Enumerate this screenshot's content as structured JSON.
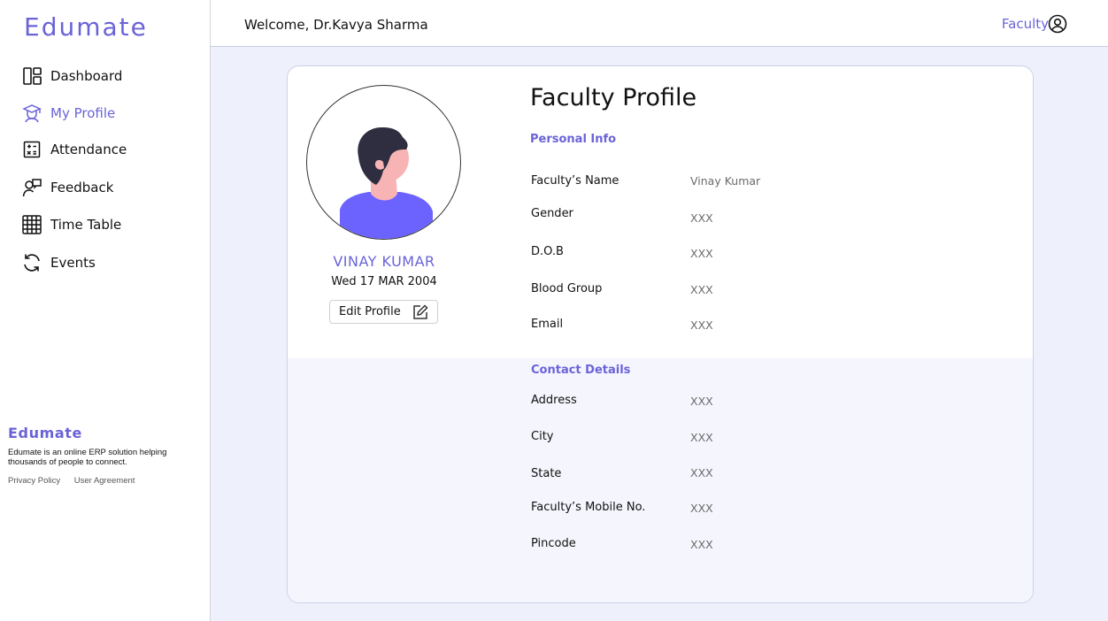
{
  "brand": "Edumate",
  "sidebar": {
    "items": [
      {
        "label": "Dashboard",
        "icon": "dashboard-icon",
        "active": false
      },
      {
        "label": "My Profile",
        "icon": "graduate-icon",
        "active": true
      },
      {
        "label": "Attendance",
        "icon": "calculator-icon",
        "active": false
      },
      {
        "label": "Feedback",
        "icon": "feedback-icon",
        "active": false
      },
      {
        "label": "Time Table",
        "icon": "grid-icon",
        "active": false
      },
      {
        "label": "Events",
        "icon": "refresh-icon",
        "active": false
      }
    ],
    "footer": {
      "brand": "Edumate",
      "description": "Edumate is an online ERP solution helping thousands of people to connect.",
      "links": [
        "Privacy Policy",
        "User Agreement"
      ]
    }
  },
  "header": {
    "welcome": "Welcome, Dr.Kavya Sharma",
    "role": "Faculty",
    "user_icon": "user-circle-icon"
  },
  "profile": {
    "name": "VINAY KUMAR",
    "date": "Wed 17 MAR 2004",
    "edit_label": "Edit Profile",
    "edit_icon": "edit-icon"
  },
  "main": {
    "title": "Faculty Profile",
    "personal_info": {
      "title": "Personal Info",
      "fields": [
        {
          "label": "Faculty’s Name",
          "value": "Vinay Kumar"
        },
        {
          "label": "Gender",
          "value": "XXX"
        },
        {
          "label": "D.O.B",
          "value": "XXX"
        },
        {
          "label": "Blood Group",
          "value": "XXX"
        },
        {
          "label": "Email",
          "value": "XXX"
        }
      ]
    },
    "contact_details": {
      "title": "Contact Details",
      "fields": [
        {
          "label": "Address",
          "value": "XXX"
        },
        {
          "label": "City",
          "value": "XXX"
        },
        {
          "label": "State",
          "value": "XXX"
        },
        {
          "label": "Faculty’s Mobile No.",
          "value": "XXX"
        },
        {
          "label": "Pincode",
          "value": "XXX"
        }
      ]
    }
  },
  "colors": {
    "accent": "#6a63d8",
    "background": "#eef0fb",
    "avatar_shirt": "#6c63ff",
    "avatar_skin": "#f8b4b4",
    "avatar_hair": "#2f2e41"
  }
}
